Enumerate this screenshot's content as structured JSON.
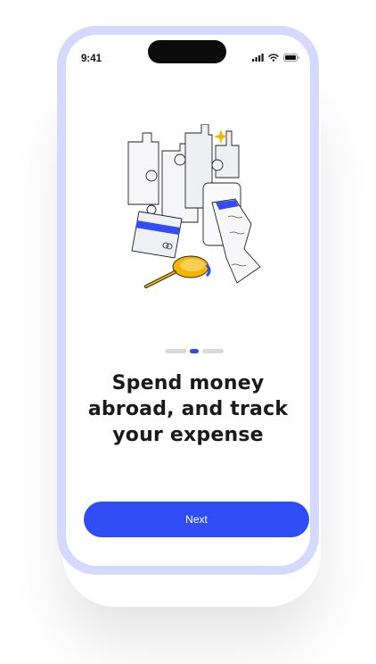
{
  "status_bar": {
    "time": "9:41"
  },
  "onboarding": {
    "headline_line1": "Spend money",
    "headline_line2": "abroad, and track",
    "headline_line3": "your expense",
    "pager": {
      "count": 3,
      "active_index": 1
    }
  },
  "actions": {
    "next_label": "Next"
  },
  "colors": {
    "accent": "#2f4cf5",
    "frame": "#d5d8ff",
    "text": "#1a1a1a",
    "pager_inactive": "#d9d9de"
  },
  "icons": [
    "signal-icon",
    "wifi-icon",
    "battery-icon"
  ]
}
